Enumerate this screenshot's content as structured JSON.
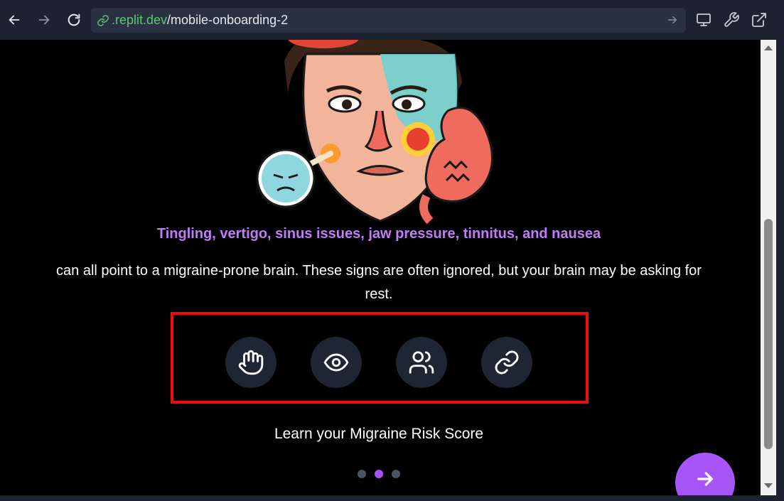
{
  "browser": {
    "url_domain": ".replit.dev",
    "url_path": "/mobile-onboarding-2"
  },
  "page": {
    "headline": "Tingling, vertigo, sinus issues, jaw pressure, tinnitus, and nausea",
    "body": "can all point to a migraine-prone brain. These signs are often ignored, but your brain may be asking for rest.",
    "cta": "Learn your Migraine Risk Score"
  },
  "icons": [
    "hand-icon",
    "eye-icon",
    "users-icon",
    "link-icon"
  ],
  "pagination": {
    "total": 3,
    "active_index": 1
  },
  "colors": {
    "accent": "#a855f7",
    "headline": "#c07df7",
    "icon_bg": "#1f2633",
    "highlight": "#f00a0a",
    "background": "#000000"
  }
}
